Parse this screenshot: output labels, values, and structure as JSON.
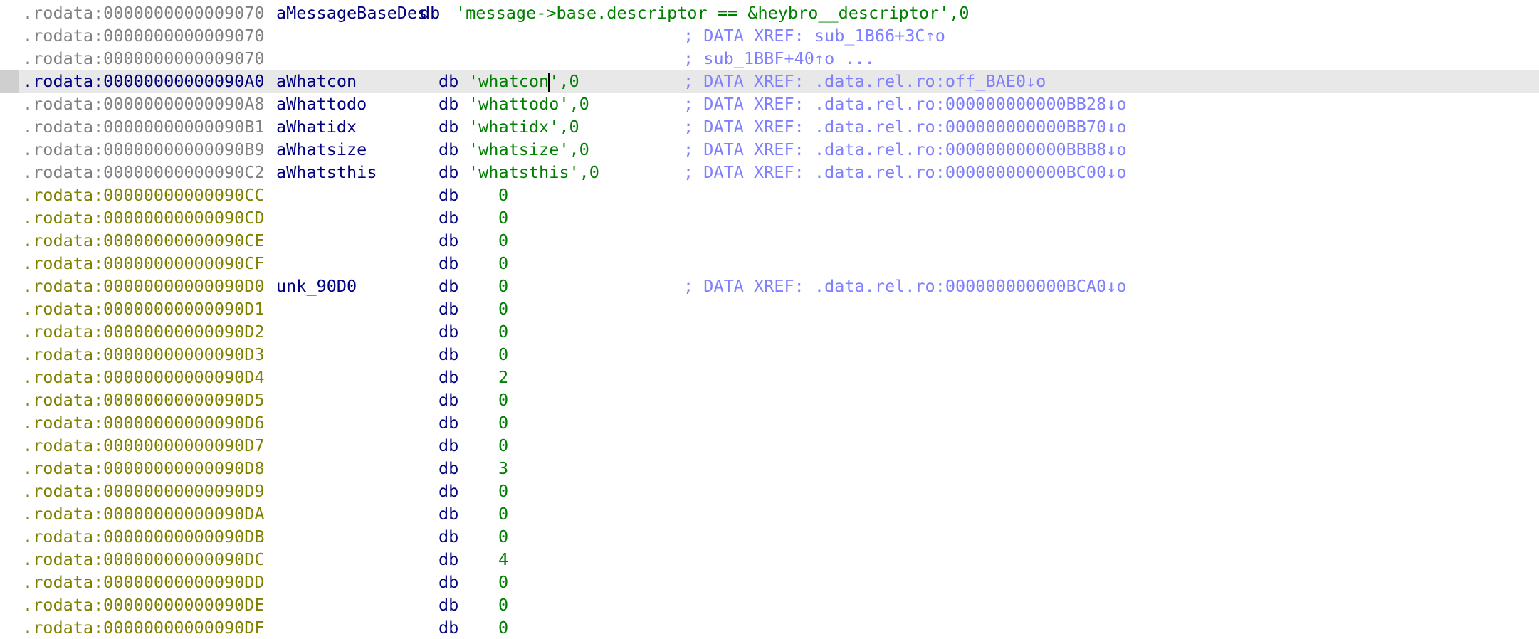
{
  "window": {
    "view": "IDA View",
    "section": ".rodata"
  },
  "colors": {
    "address_default": "#808080",
    "address_data": "#808000",
    "address_selected": "#000080",
    "name": "#000080",
    "directive": "#000080",
    "string": "#008000",
    "number": "#008000",
    "comment": "#8080ff",
    "selection_bg": "#e8e8e8"
  },
  "lines": [
    {
      "address": ".rodata:0000000000009070",
      "addr_style": "gray",
      "name": "aMessageBaseDes",
      "directive": "db",
      "operand_type": "string",
      "operand": "message->base.descriptor == &heybro__descriptor",
      "suffix": ",0",
      "comment": "",
      "selected": false,
      "layout": "long"
    },
    {
      "address": ".rodata:0000000000009070",
      "addr_style": "gray",
      "name": "",
      "directive": "",
      "operand_type": "none",
      "operand": "",
      "suffix": "",
      "comment": "; DATA XREF: sub_1B66+3C↑o",
      "selected": false
    },
    {
      "address": ".rodata:0000000000009070",
      "addr_style": "gray",
      "name": "",
      "directive": "",
      "operand_type": "none",
      "operand": "",
      "suffix": "",
      "comment": "; sub_1BBF+40↑o ...",
      "selected": false
    },
    {
      "address": ".rodata:00000000000090A0",
      "addr_style": "navy",
      "name": "aWhatcon",
      "directive": "db",
      "operand_type": "string",
      "operand": "whatcon",
      "suffix": ",0",
      "comment": "; DATA XREF: .data.rel.ro:off_BAE0↓o",
      "selected": true
    },
    {
      "address": ".rodata:00000000000090A8",
      "addr_style": "gray",
      "name": "aWhattodo",
      "directive": "db",
      "operand_type": "string",
      "operand": "whattodo",
      "suffix": ",0",
      "comment": "; DATA XREF: .data.rel.ro:000000000000BB28↓o",
      "selected": false
    },
    {
      "address": ".rodata:00000000000090B1",
      "addr_style": "gray",
      "name": "aWhatidx",
      "directive": "db",
      "operand_type": "string",
      "operand": "whatidx",
      "suffix": ",0",
      "comment": "; DATA XREF: .data.rel.ro:000000000000BB70↓o",
      "selected": false
    },
    {
      "address": ".rodata:00000000000090B9",
      "addr_style": "gray",
      "name": "aWhatsize",
      "directive": "db",
      "operand_type": "string",
      "operand": "whatsize",
      "suffix": ",0",
      "comment": "; DATA XREF: .data.rel.ro:000000000000BBB8↓o",
      "selected": false
    },
    {
      "address": ".rodata:00000000000090C2",
      "addr_style": "gray",
      "name": "aWhatsthis",
      "directive": "db",
      "operand_type": "string",
      "operand": "whatsthis",
      "suffix": ",0",
      "comment": "; DATA XREF: .data.rel.ro:000000000000BC00↓o",
      "selected": false
    },
    {
      "address": ".rodata:00000000000090CC",
      "addr_style": "olive",
      "name": "",
      "directive": "db",
      "operand_type": "number",
      "operand": "0",
      "suffix": "",
      "comment": "",
      "selected": false
    },
    {
      "address": ".rodata:00000000000090CD",
      "addr_style": "olive",
      "name": "",
      "directive": "db",
      "operand_type": "number",
      "operand": "0",
      "suffix": "",
      "comment": "",
      "selected": false
    },
    {
      "address": ".rodata:00000000000090CE",
      "addr_style": "olive",
      "name": "",
      "directive": "db",
      "operand_type": "number",
      "operand": "0",
      "suffix": "",
      "comment": "",
      "selected": false
    },
    {
      "address": ".rodata:00000000000090CF",
      "addr_style": "olive",
      "name": "",
      "directive": "db",
      "operand_type": "number",
      "operand": "0",
      "suffix": "",
      "comment": "",
      "selected": false
    },
    {
      "address": ".rodata:00000000000090D0",
      "addr_style": "olive",
      "name": "unk_90D0",
      "directive": "db",
      "operand_type": "number",
      "operand": "0",
      "suffix": "",
      "comment": "; DATA XREF: .data.rel.ro:000000000000BCA0↓o",
      "selected": false
    },
    {
      "address": ".rodata:00000000000090D1",
      "addr_style": "olive",
      "name": "",
      "directive": "db",
      "operand_type": "number",
      "operand": "0",
      "suffix": "",
      "comment": "",
      "selected": false
    },
    {
      "address": ".rodata:00000000000090D2",
      "addr_style": "olive",
      "name": "",
      "directive": "db",
      "operand_type": "number",
      "operand": "0",
      "suffix": "",
      "comment": "",
      "selected": false
    },
    {
      "address": ".rodata:00000000000090D3",
      "addr_style": "olive",
      "name": "",
      "directive": "db",
      "operand_type": "number",
      "operand": "0",
      "suffix": "",
      "comment": "",
      "selected": false
    },
    {
      "address": ".rodata:00000000000090D4",
      "addr_style": "olive",
      "name": "",
      "directive": "db",
      "operand_type": "number",
      "operand": "2",
      "suffix": "",
      "comment": "",
      "selected": false
    },
    {
      "address": ".rodata:00000000000090D5",
      "addr_style": "olive",
      "name": "",
      "directive": "db",
      "operand_type": "number",
      "operand": "0",
      "suffix": "",
      "comment": "",
      "selected": false
    },
    {
      "address": ".rodata:00000000000090D6",
      "addr_style": "olive",
      "name": "",
      "directive": "db",
      "operand_type": "number",
      "operand": "0",
      "suffix": "",
      "comment": "",
      "selected": false
    },
    {
      "address": ".rodata:00000000000090D7",
      "addr_style": "olive",
      "name": "",
      "directive": "db",
      "operand_type": "number",
      "operand": "0",
      "suffix": "",
      "comment": "",
      "selected": false
    },
    {
      "address": ".rodata:00000000000090D8",
      "addr_style": "olive",
      "name": "",
      "directive": "db",
      "operand_type": "number",
      "operand": "3",
      "suffix": "",
      "comment": "",
      "selected": false
    },
    {
      "address": ".rodata:00000000000090D9",
      "addr_style": "olive",
      "name": "",
      "directive": "db",
      "operand_type": "number",
      "operand": "0",
      "suffix": "",
      "comment": "",
      "selected": false
    },
    {
      "address": ".rodata:00000000000090DA",
      "addr_style": "olive",
      "name": "",
      "directive": "db",
      "operand_type": "number",
      "operand": "0",
      "suffix": "",
      "comment": "",
      "selected": false
    },
    {
      "address": ".rodata:00000000000090DB",
      "addr_style": "olive",
      "name": "",
      "directive": "db",
      "operand_type": "number",
      "operand": "0",
      "suffix": "",
      "comment": "",
      "selected": false
    },
    {
      "address": ".rodata:00000000000090DC",
      "addr_style": "olive",
      "name": "",
      "directive": "db",
      "operand_type": "number",
      "operand": "4",
      "suffix": "",
      "comment": "",
      "selected": false
    },
    {
      "address": ".rodata:00000000000090DD",
      "addr_style": "olive",
      "name": "",
      "directive": "db",
      "operand_type": "number",
      "operand": "0",
      "suffix": "",
      "comment": "",
      "selected": false
    },
    {
      "address": ".rodata:00000000000090DE",
      "addr_style": "olive",
      "name": "",
      "directive": "db",
      "operand_type": "number",
      "operand": "0",
      "suffix": "",
      "comment": "",
      "selected": false
    },
    {
      "address": ".rodata:00000000000090DF",
      "addr_style": "olive",
      "name": "",
      "directive": "db",
      "operand_type": "number",
      "operand": "0",
      "suffix": "",
      "comment": "",
      "selected": false
    }
  ]
}
